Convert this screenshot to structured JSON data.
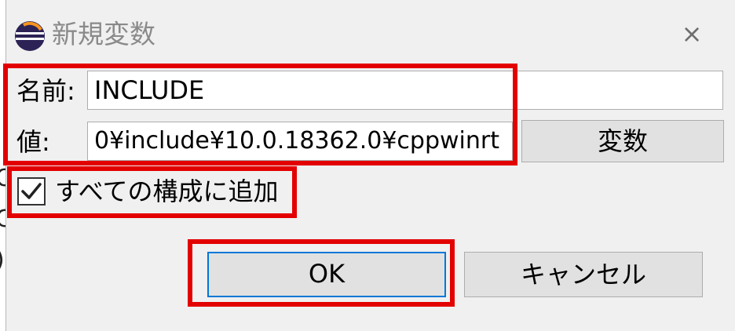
{
  "dialog": {
    "title": "新規変数",
    "close_glyph": "×"
  },
  "form": {
    "name_label": "名前:",
    "name_value": "INCLUDE",
    "value_label": "値:",
    "value_value": "0¥include¥10.0.18362.0¥cppwinrt",
    "variables_button": "変数",
    "apply_all_label": "すべての構成に追加",
    "apply_all_checked": true
  },
  "buttons": {
    "ok": "OK",
    "cancel": "キャンセル"
  },
  "colors": {
    "highlight": "#e30000",
    "default_button_border": "#0078d7",
    "dialog_bg": "#f0f0f0"
  },
  "icons": {
    "app": "eclipse-icon",
    "close": "close-icon",
    "check": "checkmark-icon"
  }
}
